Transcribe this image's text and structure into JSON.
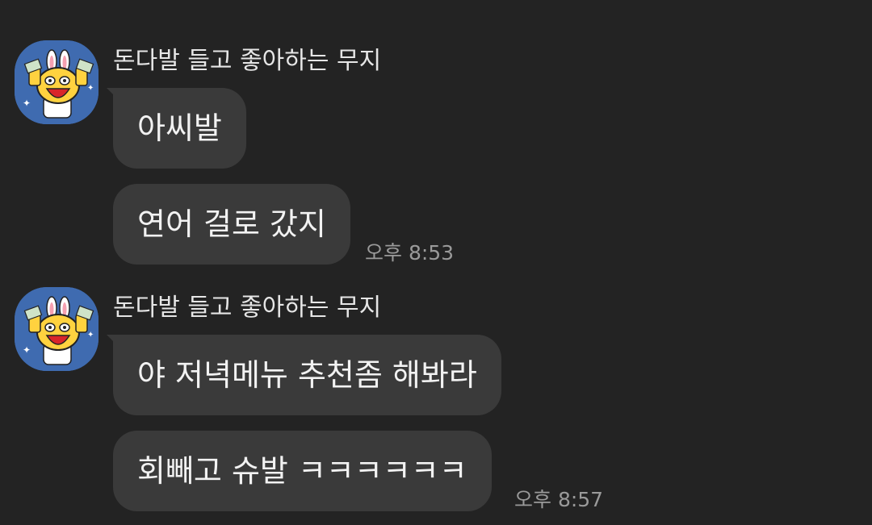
{
  "chat": {
    "groups": [
      {
        "sender": "돈다발 들고 좋아하는 무지",
        "messages": [
          "아씨발",
          "연어 걸로 갔지"
        ],
        "time": "오후 8:53"
      },
      {
        "sender": "돈다발 들고 좋아하는 무지",
        "messages": [
          "야 저녁메뉴 추천좀 해봐라",
          "회빼고 슈발 ㅋㅋㅋㅋㅋㅋ"
        ],
        "time": "오후 8:57"
      }
    ],
    "avatar_icon": "muzi-character-avatar",
    "colors": {
      "background": "#232323",
      "bubble": "#3a3a3a",
      "avatar_bg": "#3f6bb0"
    }
  }
}
